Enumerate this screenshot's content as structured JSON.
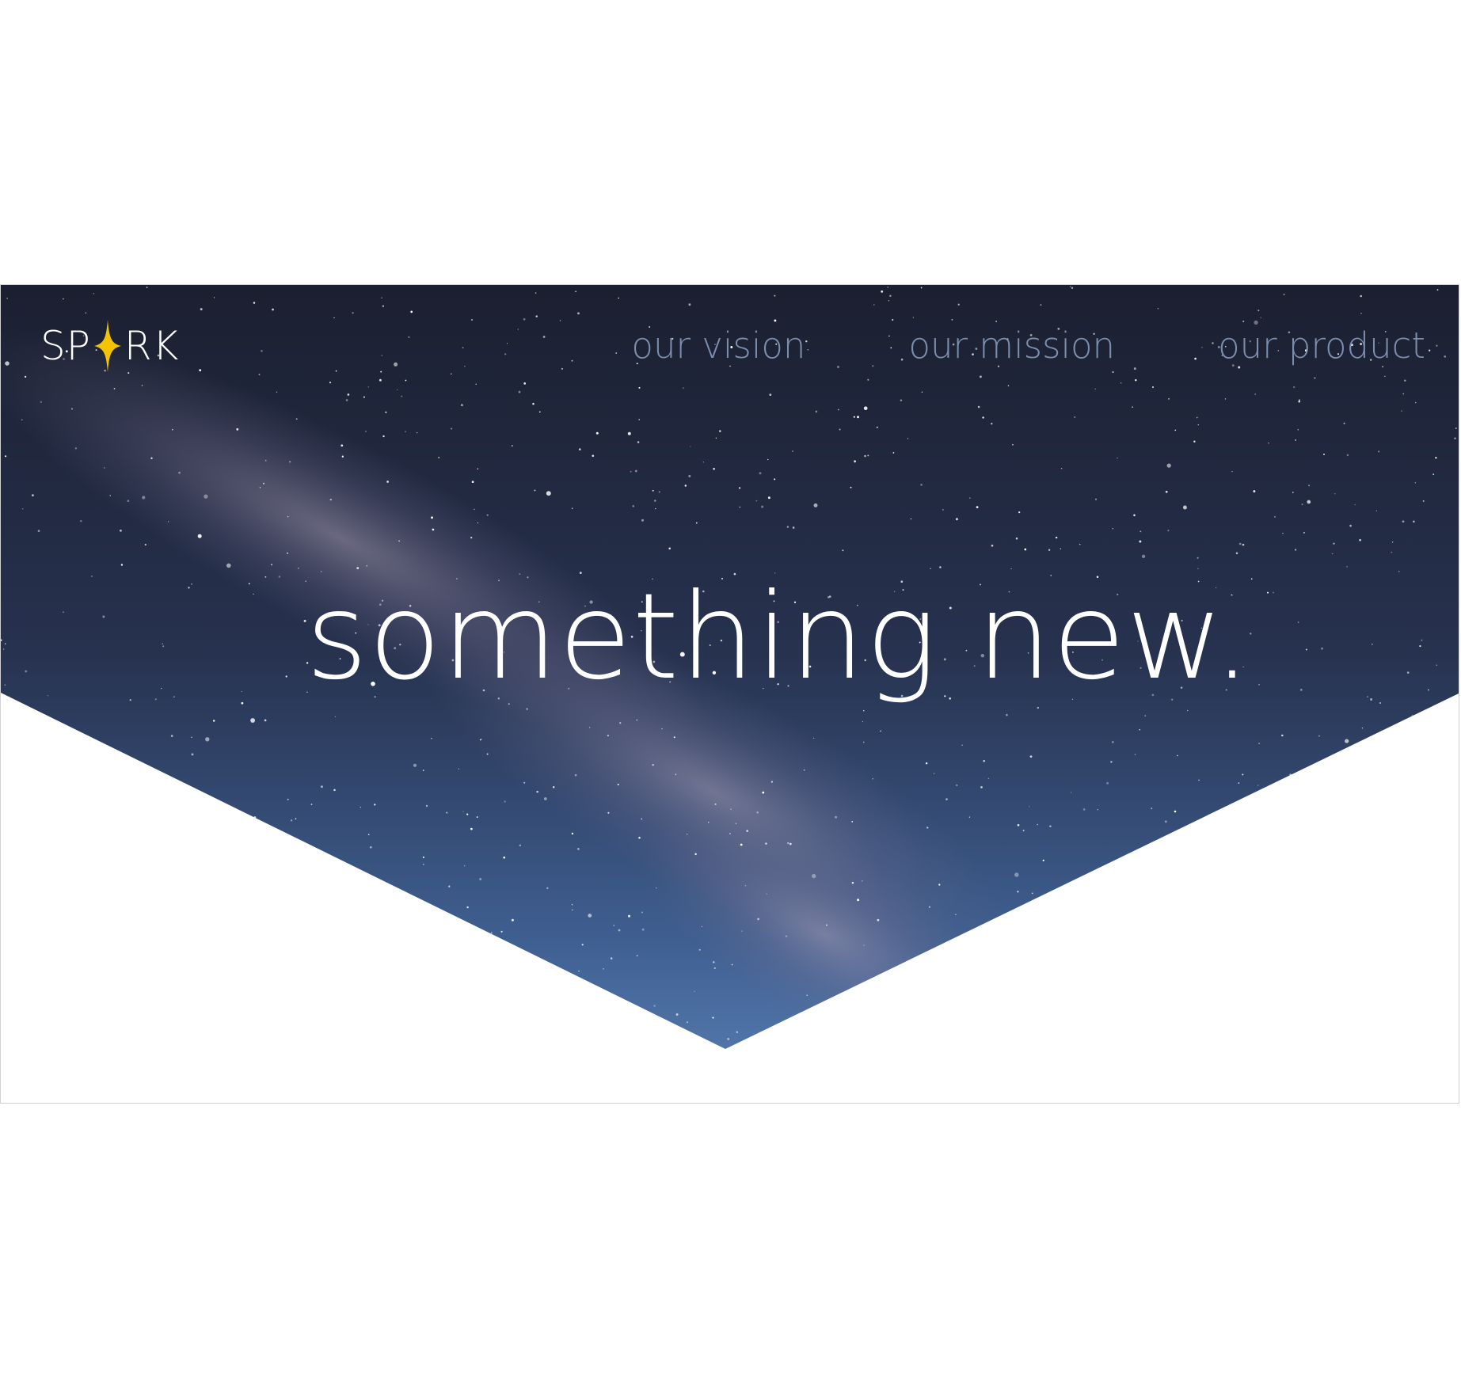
{
  "brand": {
    "prefix": "SP",
    "suffix": "RK",
    "logo_alt": "SPARK",
    "star_color": "#f5c400"
  },
  "nav": {
    "items": [
      {
        "label": "our vision"
      },
      {
        "label": "our mission"
      },
      {
        "label": "our product"
      }
    ],
    "color": "#7d8fae"
  },
  "hero": {
    "headline": "something new.",
    "sky_top_color": "#1d2133",
    "sky_bottom_color": "#4b6fa3"
  }
}
